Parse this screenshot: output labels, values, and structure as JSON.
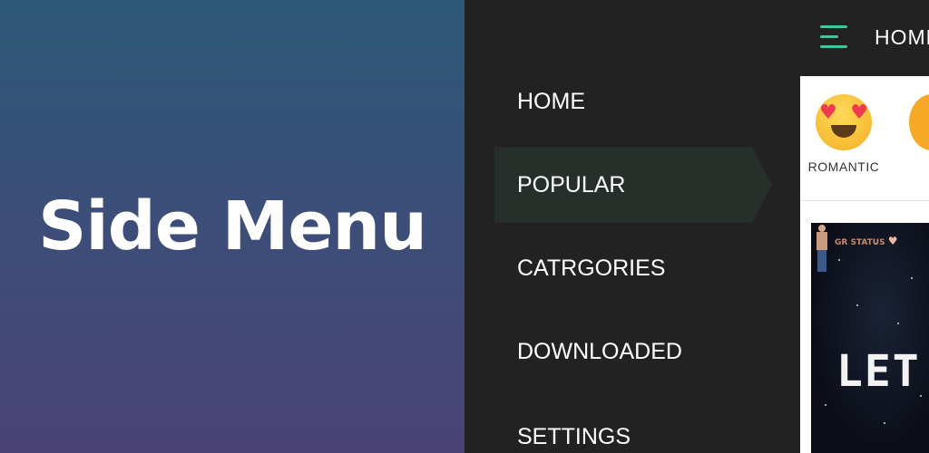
{
  "promo": {
    "title": "Side Menu"
  },
  "topbar": {
    "title": "HOME",
    "menu_icon": "hamburger-menu-icon",
    "accent": "#3ec6a0"
  },
  "side_menu": {
    "items": [
      {
        "label": "HOME"
      },
      {
        "label": "POPULAR",
        "active": true
      },
      {
        "label": "CATRGORIES"
      },
      {
        "label": "DOWNLOADED"
      },
      {
        "label": "SETTINGS"
      }
    ],
    "background": "#222222",
    "active_background": "#272f2b"
  },
  "categories": [
    {
      "label": "ROMANTIC",
      "icon": "heart-eyes-emoji-icon"
    },
    {
      "label": "",
      "icon": "emoji-icon"
    }
  ],
  "card": {
    "text": "LET I",
    "brand_mark": "GR\nSTATUS",
    "brand_icon": "heart-icon"
  },
  "colors": {
    "promo_top": "#2d5878",
    "promo_bottom": "#4a4275"
  }
}
